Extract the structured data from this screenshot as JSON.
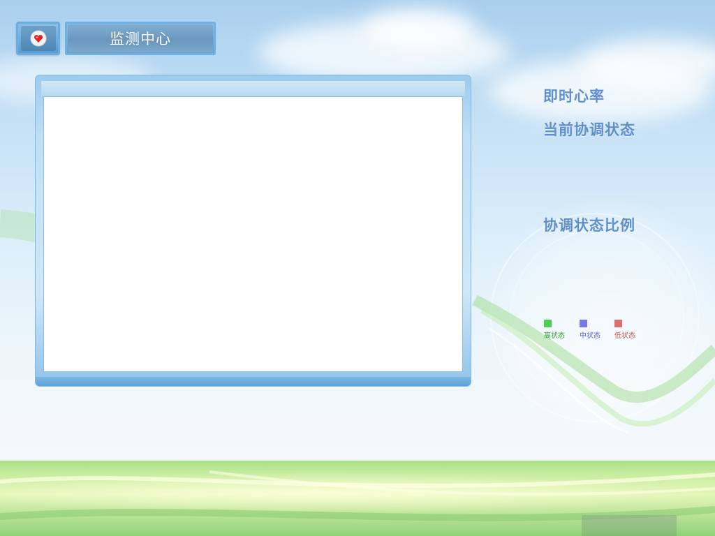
{
  "header": {
    "logo_icon": "heart-icon",
    "title": "监测中心"
  },
  "main_panel": {
    "content": ""
  },
  "side": {
    "heart_rate_label": "即时心率",
    "current_status_label": "当前协调状态",
    "ratio_label": "协调状态比例",
    "legend": [
      {
        "label": "高状态",
        "color": "#4fcf4f",
        "text_color": "#2f9a2f"
      },
      {
        "label": "中状态",
        "color": "#7a7ae6",
        "text_color": "#5b5bd0"
      },
      {
        "label": "低状态",
        "color": "#d87070",
        "text_color": "#c25454"
      }
    ]
  },
  "colors": {
    "accent_blue": "#5f9fd6",
    "heading_blue": "#5f8fcc",
    "ground_green": "#a9df86"
  }
}
